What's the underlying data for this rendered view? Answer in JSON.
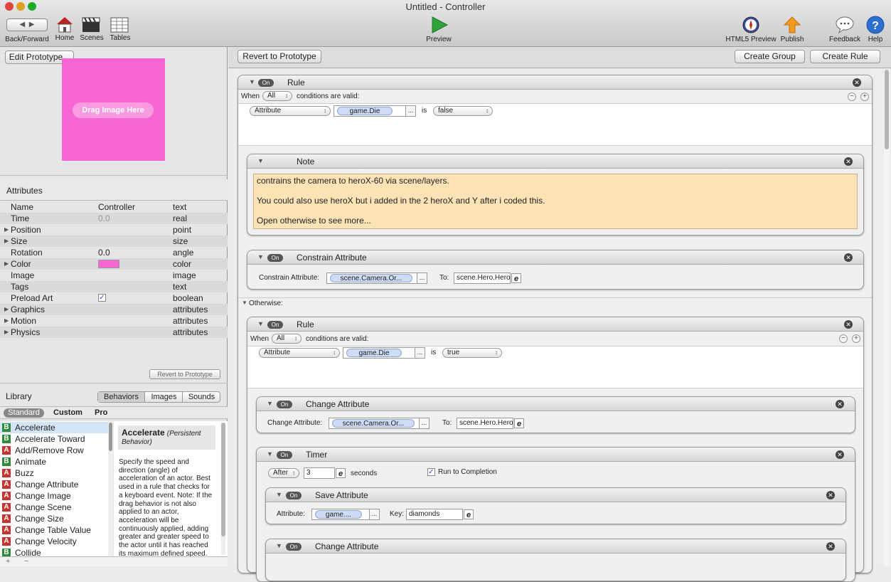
{
  "window": {
    "title": "Untitled - Controller"
  },
  "toolbar": {
    "back_forward": "Back/Forward",
    "home": "Home",
    "scenes": "Scenes",
    "tables": "Tables",
    "preview": "Preview",
    "html5_preview": "HTML5 Preview",
    "publish": "Publish",
    "feedback": "Feedback",
    "help": "Help"
  },
  "prototype": {
    "edit_button": "Edit Prototype...",
    "drag_image": "Drag Image Here",
    "color": "#f766d3"
  },
  "attributes": {
    "title": "Attributes",
    "rows": [
      {
        "name": "Name",
        "value": "Controller",
        "type": "text",
        "expand": false
      },
      {
        "name": "Time",
        "value": "0.0",
        "type": "real",
        "expand": false
      },
      {
        "name": "Position",
        "value": "",
        "type": "point",
        "expand": true
      },
      {
        "name": "Size",
        "value": "",
        "type": "size",
        "expand": true
      },
      {
        "name": "Rotation",
        "value": "0.0",
        "type": "angle",
        "expand": false
      },
      {
        "name": "Color",
        "value": "",
        "type": "color",
        "expand": true
      },
      {
        "name": "Image",
        "value": "",
        "type": "image",
        "expand": false
      },
      {
        "name": "Tags",
        "value": "",
        "type": "text",
        "expand": false
      },
      {
        "name": "Preload Art",
        "value": "",
        "type": "boolean",
        "expand": false
      },
      {
        "name": "Graphics",
        "value": "",
        "type": "attributes",
        "expand": true
      },
      {
        "name": "Motion",
        "value": "",
        "type": "attributes",
        "expand": true
      },
      {
        "name": "Physics",
        "value": "",
        "type": "attributes",
        "expand": true
      }
    ],
    "revert_button": "Revert to Prototype"
  },
  "library": {
    "title": "Library",
    "tabs": [
      "Behaviors",
      "Images",
      "Sounds"
    ],
    "subtabs": [
      "Standard",
      "Custom",
      "Pro"
    ],
    "items": [
      {
        "badge": "B",
        "label": "Accelerate"
      },
      {
        "badge": "B",
        "label": "Accelerate Toward"
      },
      {
        "badge": "A",
        "label": "Add/Remove Row"
      },
      {
        "badge": "B",
        "label": "Animate"
      },
      {
        "badge": "A",
        "label": "Buzz"
      },
      {
        "badge": "A",
        "label": "Change Attribute"
      },
      {
        "badge": "A",
        "label": "Change Image"
      },
      {
        "badge": "A",
        "label": "Change Scene"
      },
      {
        "badge": "A",
        "label": "Change Size"
      },
      {
        "badge": "A",
        "label": "Change Table Value"
      },
      {
        "badge": "A",
        "label": "Change Velocity"
      },
      {
        "badge": "B",
        "label": "Collide"
      }
    ],
    "desc_title": "Accelerate",
    "desc_subtitle": "(Persistent Behavior)",
    "desc_body": "Specify the speed and direction (angle) of acceleration of an actor. Best used in a rule that checks for a keyboard event. Note: If the drag behavior is not also applied to an actor, acceleration will be continuously applied, adding greater and greater speed to the actor until it has reached its maximum defined speed."
  },
  "editor": {
    "revert_button": "Revert to Prototype",
    "create_group": "Create Group",
    "create_rule": "Create Rule",
    "on": "On",
    "rule1": {
      "title": "Rule",
      "when": "When",
      "all": "All",
      "conds": "conditions are valid:",
      "attr_popup": "Attribute",
      "attr": "game.Die",
      "is": "is",
      "val": "false"
    },
    "note": {
      "title": "Note",
      "line1": "contrains the camera to heroX-60 via scene/layers.",
      "line2": "You could also use heroX but i added in the 2 heroX and Y after i coded this.",
      "line3": "Open otherwise to see more..."
    },
    "constrain": {
      "title": "Constrain Attribute",
      "label": "Constrain Attribute:",
      "attr": "scene.Camera.Or...",
      "to": "To:",
      "expr": "scene.Hero.Hero"
    },
    "otherwise": "Otherwise:",
    "rule2": {
      "title": "Rule",
      "when": "When",
      "all": "All",
      "conds": "conditions are valid:",
      "attr_popup": "Attribute",
      "attr": "game.Die",
      "is": "is",
      "val": "true"
    },
    "change1": {
      "title": "Change Attribute",
      "label": "Change Attribute:",
      "attr": "scene.Camera.Or...",
      "to": "To:",
      "expr": "scene.Hero.Hero"
    },
    "timer": {
      "title": "Timer",
      "after": "After",
      "value": "3",
      "seconds": "seconds",
      "run": "Run to Completion"
    },
    "save": {
      "title": "Save Attribute",
      "label": "Attribute:",
      "attr": "game....",
      "key_label": "Key:",
      "key": "diamonds"
    },
    "change2": {
      "title": "Change Attribute"
    }
  }
}
